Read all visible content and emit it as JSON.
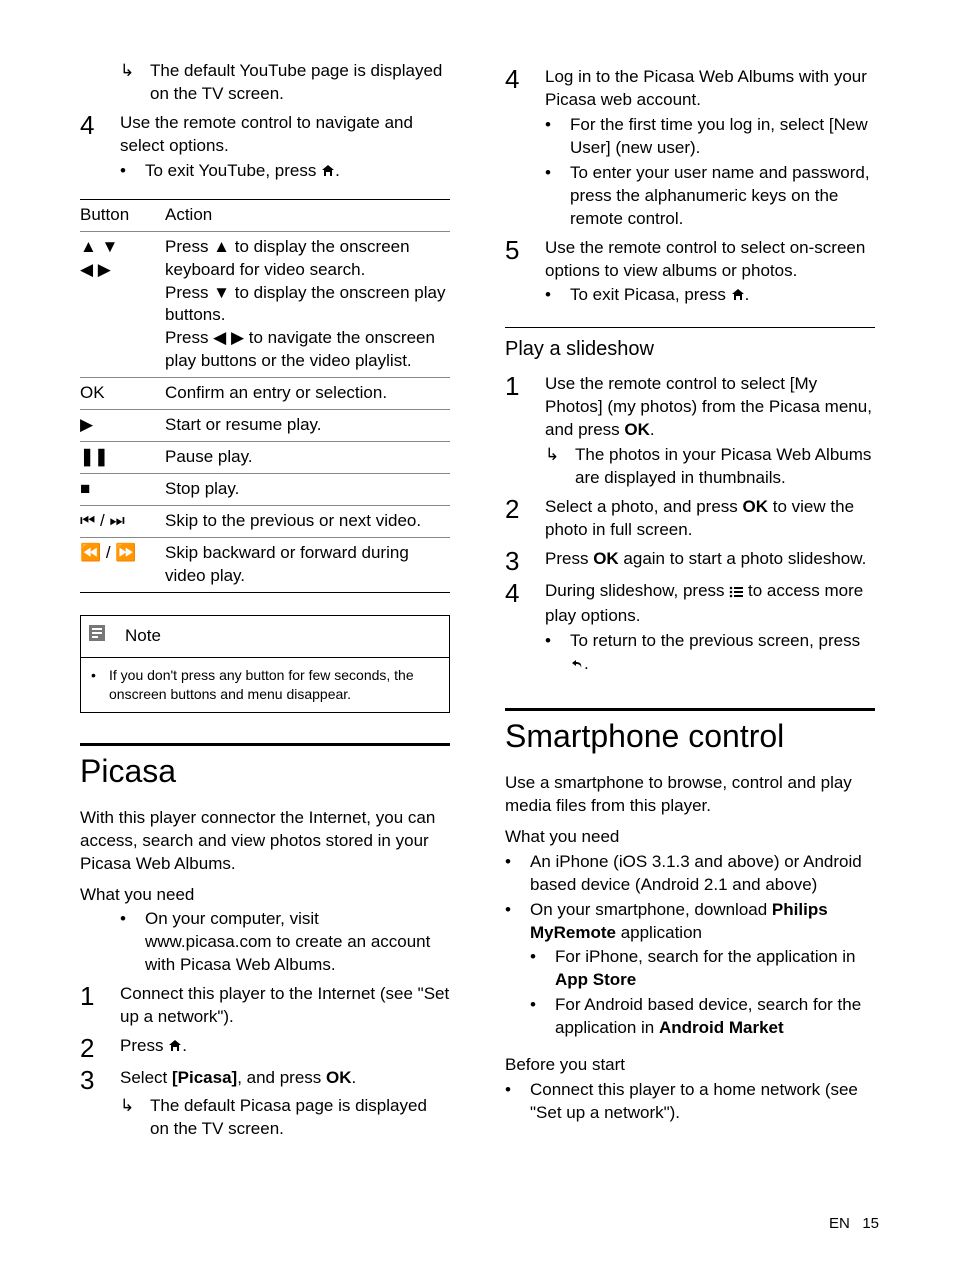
{
  "left": {
    "youtube_result": "The default YouTube page is displayed on the TV screen.",
    "step4": "Use the remote control to navigate and select options.",
    "step4_sub": "To exit YouTube, press ",
    "table": {
      "head": [
        "Button",
        "Action"
      ],
      "rows": [
        {
          "btn": "▲ ▼\n◀ ▶",
          "action": "Press ▲ to display the onscreen keyboard for video search.\nPress ▼ to display the onscreen play buttons.\nPress ◀ ▶ to navigate the onscreen play buttons or the video playlist."
        },
        {
          "btn": "OK",
          "action": "Confirm an entry or selection."
        },
        {
          "btn": "▶",
          "action": "Start or resume play."
        },
        {
          "btn": "❚❚",
          "action": "Pause play."
        },
        {
          "btn": "■",
          "action": "Stop play."
        },
        {
          "btn": "⏮ / ⏭",
          "action": "Skip to the previous or next video."
        },
        {
          "btn": "⏪ / ⏩",
          "action": "Skip backward or forward during video play."
        }
      ]
    },
    "note_label": "Note",
    "note_text": "If you don't press any button for few seconds, the onscreen buttons and menu disappear.",
    "picasa_title": "Picasa",
    "picasa_intro": "With this player connector the Internet, you can access, search and view photos stored in your Picasa Web Albums.",
    "wyn": "What you need",
    "wyn_item": "On your computer, visit www.picasa.com to create an account with Picasa Web Albums.",
    "p1": "Connect this player to the Internet (see \"Set up a network\").",
    "p2": "Press ",
    "p3a": "Select ",
    "p3b": "[Picasa]",
    "p3c": ", and press ",
    "p3d": "OK",
    "p3_result": "The default Picasa page is displayed on the TV screen."
  },
  "right": {
    "s4": "Log in to the Picasa Web Albums with your Picasa web account.",
    "s4a": "For the first time you log in, select [New User] (new user).",
    "s4b": "To enter your user name and password, press the alphanumeric keys on the remote control.",
    "s5": "Use the remote control to select on-screen options to view albums or photos.",
    "s5a": "To exit Picasa, press ",
    "slide_title": "Play a slideshow",
    "sl1a": "Use the remote control to select [My Photos] (my photos) from the Picasa menu, and press ",
    "sl1b": "OK",
    "sl1_res": "The photos in your Picasa Web Albums are displayed in thumbnails.",
    "sl2a": "Select a photo, and press ",
    "sl2b": "OK",
    "sl2c": " to view the photo in full screen.",
    "sl3a": "Press ",
    "sl3b": "OK",
    "sl3c": " again to start a photo slideshow.",
    "sl4a": "During slideshow, press ",
    "sl4b": " to access more play options.",
    "sl4_sub": "To return to the previous screen, press ",
    "phone_title": "Smartphone control",
    "phone_intro": "Use a smartphone to browse, control and play media files from this player.",
    "wyn": "What you need",
    "wyn1": "An iPhone (iOS 3.1.3 and above) or Android based device (Android 2.1 and above)",
    "wyn2a": "On your smartphone, download ",
    "wyn2b": "Philips MyRemote",
    "wyn2c": " application",
    "wyn2_s1a": "For iPhone, search for the application in ",
    "wyn2_s1b": "App Store",
    "wyn2_s2a": "For Android based device, search for the application in ",
    "wyn2_s2b": "Android Market",
    "bys": "Before you start",
    "bys1": "Connect this player to a home network (see \"Set up a network\")."
  },
  "footer": {
    "lang": "EN",
    "page": "15"
  }
}
